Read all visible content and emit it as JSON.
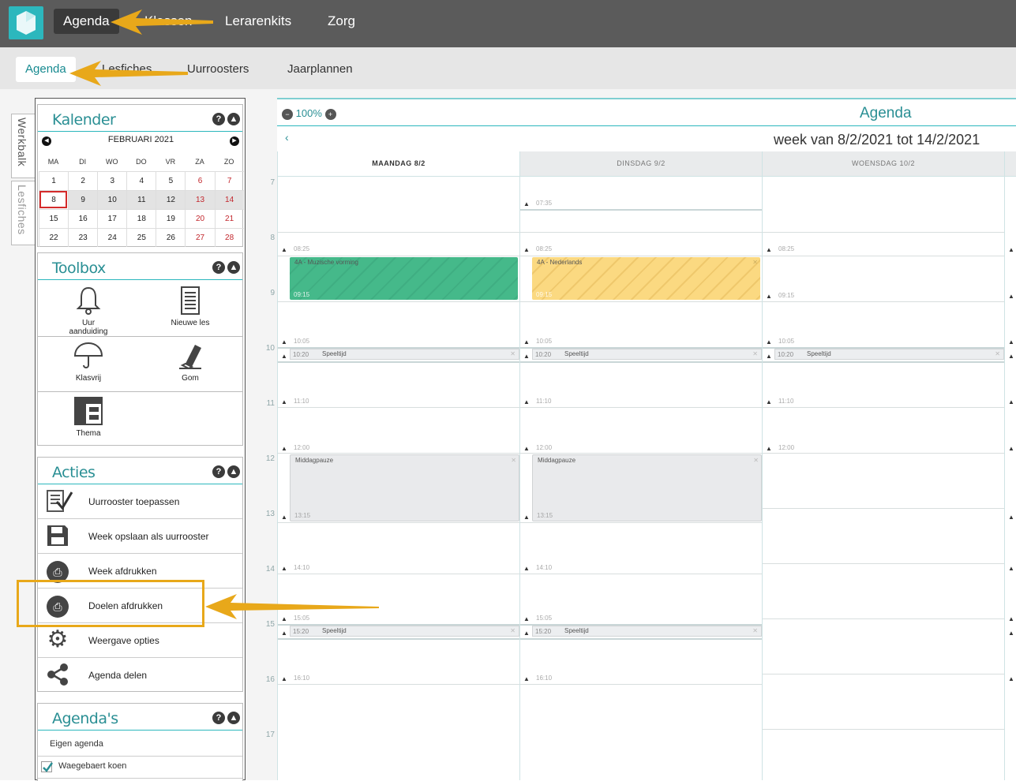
{
  "topnav": {
    "items": [
      {
        "label": "Agenda",
        "active": true
      },
      {
        "label": "Klassen",
        "active": false
      },
      {
        "label": "Lerarenkits",
        "active": false
      },
      {
        "label": "Zorg",
        "active": false
      }
    ]
  },
  "subnav": {
    "items": [
      {
        "label": "Agenda",
        "active": true
      },
      {
        "label": "Lesfiches",
        "active": false
      },
      {
        "label": "Uurroosters",
        "active": false
      },
      {
        "label": "Jaarplannen",
        "active": false
      }
    ]
  },
  "sidetabs": {
    "werkbalk": "Werkbalk",
    "lesfiches": "Lesfiches"
  },
  "kalender": {
    "title": "Kalender",
    "month": "FEBRUARI 2021",
    "dow": [
      "MA",
      "DI",
      "WO",
      "DO",
      "VR",
      "ZA",
      "ZO"
    ],
    "weeks": [
      [
        "1",
        "2",
        "3",
        "4",
        "5",
        "6",
        "7"
      ],
      [
        "8",
        "9",
        "10",
        "11",
        "12",
        "13",
        "14"
      ],
      [
        "15",
        "16",
        "17",
        "18",
        "19",
        "20",
        "21"
      ],
      [
        "22",
        "23",
        "24",
        "25",
        "26",
        "27",
        "28"
      ]
    ],
    "selected": "8"
  },
  "toolbox": {
    "title": "Toolbox",
    "items": {
      "uur": {
        "label": "Uur aanduiding",
        "icon": "bell-icon"
      },
      "nieuwe": {
        "label": "Nieuwe les",
        "icon": "document-icon"
      },
      "klasvrij": {
        "label": "Klasvrij",
        "icon": "umbrella-icon"
      },
      "gom": {
        "label": "Gom",
        "icon": "eraser-icon"
      },
      "thema": {
        "label": "Thema",
        "icon": "layout-icon"
      }
    }
  },
  "acties": {
    "title": "Acties",
    "items": [
      {
        "label": "Uurrooster toepassen",
        "icon": "checklist-icon"
      },
      {
        "label": "Week opslaan als uurrooster",
        "icon": "save-icon"
      },
      {
        "label": "Week afdrukken",
        "icon": "printer-icon"
      },
      {
        "label": "Doelen afdrukken",
        "icon": "printer-icon"
      },
      {
        "label": "Weergave opties",
        "icon": "gear-icon"
      },
      {
        "label": "Agenda delen",
        "icon": "share-icon"
      }
    ]
  },
  "agendas": {
    "title": "Agenda's",
    "own": "Eigen agenda",
    "user": "Waegebaert koen"
  },
  "main": {
    "zoom": "100%",
    "title": "Agenda",
    "week_range": "week van 8/2/2021 tot 14/2/2021",
    "hours": [
      "7",
      "8",
      "9",
      "10",
      "11",
      "12",
      "13",
      "14",
      "15",
      "16",
      "17"
    ],
    "days": [
      {
        "label": "MAANDAG 8/2"
      },
      {
        "label": "DINSDAG 9/2"
      },
      {
        "label": "WOENSDAG 10/2"
      }
    ],
    "times": {
      "t0735": "07:35",
      "t0825": "08:25",
      "t0915": "09:15",
      "t1005": "10:05",
      "t1020": "10:20",
      "t1110": "11:10",
      "t1200": "12:00",
      "t1315": "13:15",
      "t1410": "14:10",
      "t1505": "15:05",
      "t1520": "15:20",
      "t1610": "16:10"
    },
    "events": {
      "ma_les": "4A - Muzische vorming",
      "di_les": "4A - Nederlands",
      "speeltijd": "Speeltijd",
      "middag": "Middagpauze"
    }
  },
  "colors": {
    "accent": "#2cb7bd",
    "green_event": "#45b98a",
    "yellow_event": "#fbd981",
    "arrow": "#e8a81a",
    "highlight": "#e8a81a"
  }
}
